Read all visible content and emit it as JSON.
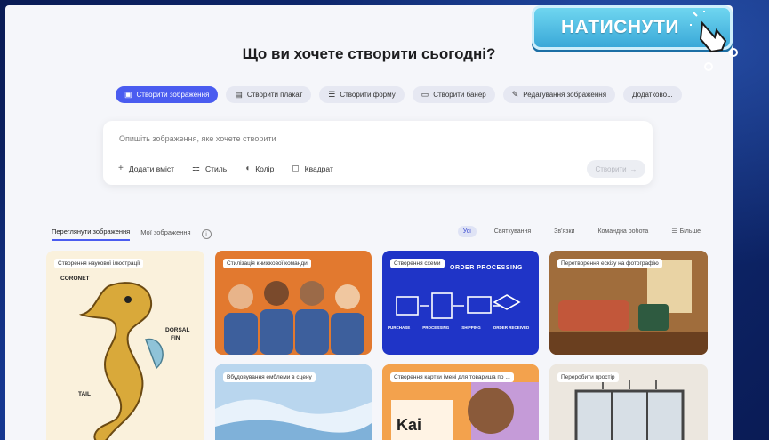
{
  "title": "Що ви хочете створити сьогодні?",
  "pills": [
    {
      "label": "Створити зображення",
      "icon": "image-icon",
      "active": true
    },
    {
      "label": "Створити плакат",
      "icon": "poster-icon",
      "active": false
    },
    {
      "label": "Створити форму",
      "icon": "form-icon",
      "active": false
    },
    {
      "label": "Створити банер",
      "icon": "banner-icon",
      "active": false
    },
    {
      "label": "Редагування зображення",
      "icon": "edit-image-icon",
      "active": false
    },
    {
      "label": "Додатково...",
      "icon": "",
      "active": false
    }
  ],
  "prompt": {
    "placeholder": "Опишіть зображення, яке хочете створити",
    "tools": [
      {
        "label": "Додати вміст",
        "icon": "plus-icon"
      },
      {
        "label": "Стиль",
        "icon": "style-icon"
      },
      {
        "label": "Колір",
        "icon": "color-icon"
      },
      {
        "label": "Квадрат",
        "icon": "square-icon"
      }
    ],
    "create_label": "Створити"
  },
  "tabs": [
    {
      "label": "Переглянути зображення",
      "active": true
    },
    {
      "label": "Мої зображення",
      "active": false
    }
  ],
  "filters": [
    {
      "label": "Усі",
      "active": true
    },
    {
      "label": "Святкування",
      "active": false
    },
    {
      "label": "Зв'язки",
      "active": false
    },
    {
      "label": "Командна робота",
      "active": false
    },
    {
      "label": "Більше",
      "active": false,
      "icon": "filter-icon"
    }
  ],
  "cards": [
    {
      "label": "Створення наукової ілюстрації",
      "annotations": [
        "CORONET",
        "DORSAL",
        "FIN",
        "TAIL"
      ]
    },
    {
      "label": "Стилізація книжкової команди"
    },
    {
      "label": "Створення схеми",
      "heading": "ORDER PROCESSING",
      "steps": [
        "PURCHASE",
        "PROCESSING",
        "SHIPPING",
        "ORDER RECEIVED"
      ]
    },
    {
      "label": "Перетворення ескізу на фотографію"
    },
    {
      "label": "Вбудовування емблеми в сцену"
    },
    {
      "label": "Створення картки імені для товариша по ...",
      "name_text": "Kai"
    },
    {
      "label": "Переробити простір"
    }
  ],
  "overlay": {
    "label": "НАТИСНУТИ"
  }
}
